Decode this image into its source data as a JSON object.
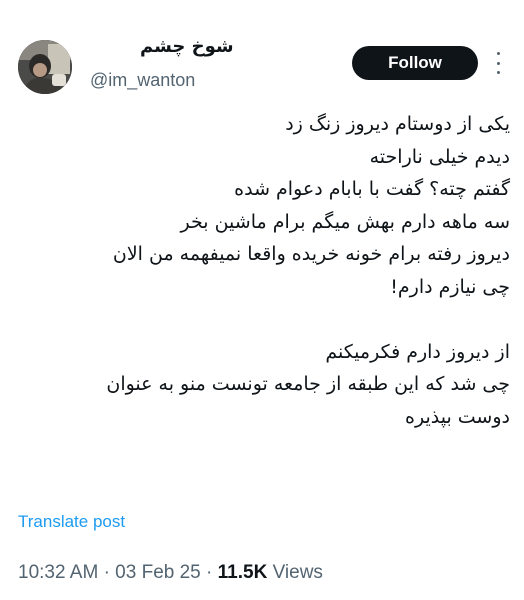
{
  "author": {
    "display_name": "شوخ چشم",
    "handle": "@im_wanton"
  },
  "actions": {
    "follow_label": "Follow"
  },
  "tweet": {
    "lines": [
      "یکی از دوستام دیروز زنگ زد",
      "دیدم خیلی ناراحته",
      "گفتم چته؟ گفت با بابام دعوام شده",
      "سه ماهه دارم بهش میگم برام ماشین بخر",
      "دیروز رفته برام خونه خریده واقعا نمیفهمه من الان",
      "چی نیازم دارم!",
      "",
      "از دیروز دارم فکرمیکنم",
      "چی شد که این طبقه از جامعه تونست منو به عنوان",
      "دوست بپذیره"
    ]
  },
  "translate_label": "Translate post",
  "meta": {
    "time": "10:32 AM",
    "date": "03 Feb 25",
    "separator": "·",
    "views_count": "11.5K",
    "views_label": "Views"
  },
  "colors": {
    "text_primary": "#0f1419",
    "text_secondary": "#536471",
    "link": "#1d9bf0",
    "follow_bg": "#0f1419"
  },
  "icons": {
    "avatar": "profile-photo",
    "more": "more-vertical-icon"
  }
}
